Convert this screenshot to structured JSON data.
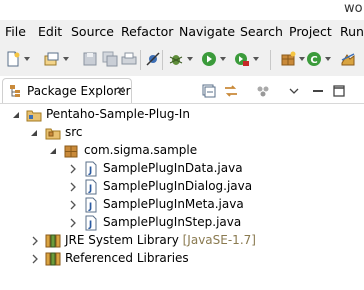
{
  "window": {
    "title": "wo"
  },
  "menu": [
    "File",
    "Edit",
    "Source",
    "Refactor",
    "Navigate",
    "Search",
    "Project",
    "Run"
  ],
  "toolbar": {
    "icons": [
      "new-icon",
      "new-project-icon",
      "save-icon",
      "save-all-icon",
      "print-icon",
      "skip-breakpoints-icon",
      "debug-icon",
      "run-icon",
      "external-tools-icon",
      "new-java-package-icon",
      "new-java-class-icon",
      "open-type-icon"
    ]
  },
  "view": {
    "tab_label": "Package Explorer",
    "close_glyph": "✕"
  },
  "tree": {
    "project": "Pentaho-Sample-Plug-In",
    "src": "src",
    "package": "com.sigma.sample",
    "files": [
      "SamplePlugInData.java",
      "SamplePlugInDialog.java",
      "SamplePlugInMeta.java",
      "SamplePlugInStep.java"
    ],
    "jre_label": "JRE System Library",
    "jre_decoration": "[JavaSE-1.7]",
    "referenced": "Referenced Libraries"
  }
}
